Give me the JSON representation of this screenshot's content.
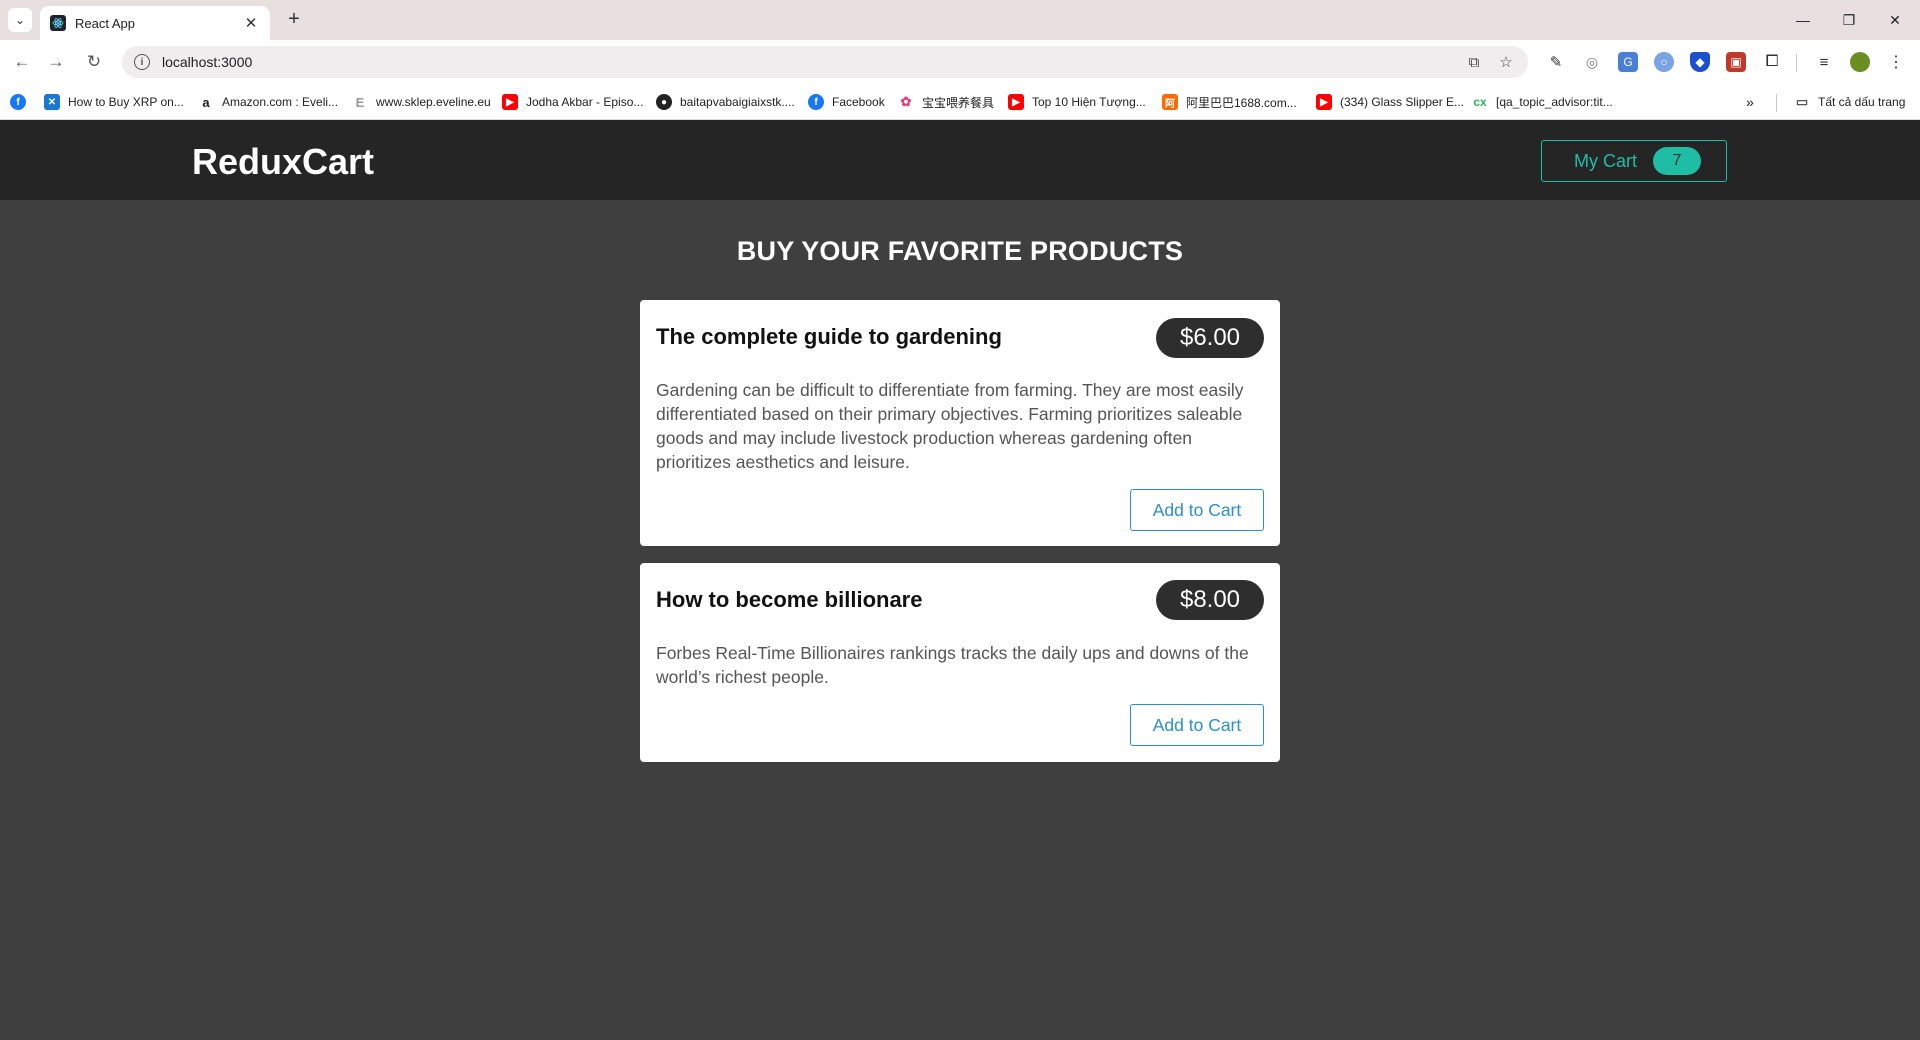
{
  "browser": {
    "tab_title": "React App",
    "address": "localhost:3000",
    "bookmarks": [
      {
        "label": "How to Buy XRP on...",
        "icon": "xrp-icon",
        "color": "#1976d2"
      },
      {
        "label": "Amazon.com : Eveli...",
        "icon": "amazon-icon",
        "color": "#222222"
      },
      {
        "label": "www.sklep.eveline.eu",
        "icon": "eveline-icon",
        "color": "#999999"
      },
      {
        "label": "Jodha Akbar - Episo...",
        "icon": "youtube-icon",
        "color": "#ff0000"
      },
      {
        "label": "baitapvabaigiaixstk....",
        "icon": "globe-icon",
        "color": "#222222"
      },
      {
        "label": "Facebook",
        "icon": "facebook-icon",
        "color": "#1877f2"
      },
      {
        "label": "宝宝喂养餐具",
        "icon": "flower-icon",
        "color": "#e9407a"
      },
      {
        "label": "Top 10 Hiện Tượng...",
        "icon": "youtube-icon",
        "color": "#ff0000"
      },
      {
        "label": "阿里巴巴1688.com...",
        "icon": "alibaba-icon",
        "color": "#ff6a00"
      },
      {
        "label": "(334) Glass Slipper E...",
        "icon": "youtube-icon",
        "color": "#ff0000"
      },
      {
        "label": "[qa_topic_advisor:tit...",
        "icon": "cx-icon",
        "color": "#2eaf5a"
      }
    ],
    "all_bookmarks_label": "Tất cả dấu trang"
  },
  "navbar": {
    "brand": "ReduxCart",
    "cart_label": "My Cart",
    "cart_count": "7"
  },
  "main": {
    "heading": "BUY YOUR FAVORITE PRODUCTS",
    "products": [
      {
        "title": "The complete guide to gardening",
        "price": "$6.00",
        "description": "Gardening can be difficult to differentiate from farming. They are most easily differentiated based on their primary objectives. Farming prioritizes saleable goods and may include livestock production whereas gardening often prioritizes aesthetics and leisure.",
        "button": "Add to Cart"
      },
      {
        "title": "How to become billionare",
        "price": "$8.00",
        "description": "Forbes Real-Time Billionaires rankings tracks the daily ups and downs of the world’s richest people.",
        "button": "Add to Cart"
      }
    ]
  },
  "colors": {
    "accent": "#1fbda6",
    "button_blue": "#2a8fd0",
    "navbar_bg": "#252525",
    "page_bg": "#3f3f3f"
  }
}
